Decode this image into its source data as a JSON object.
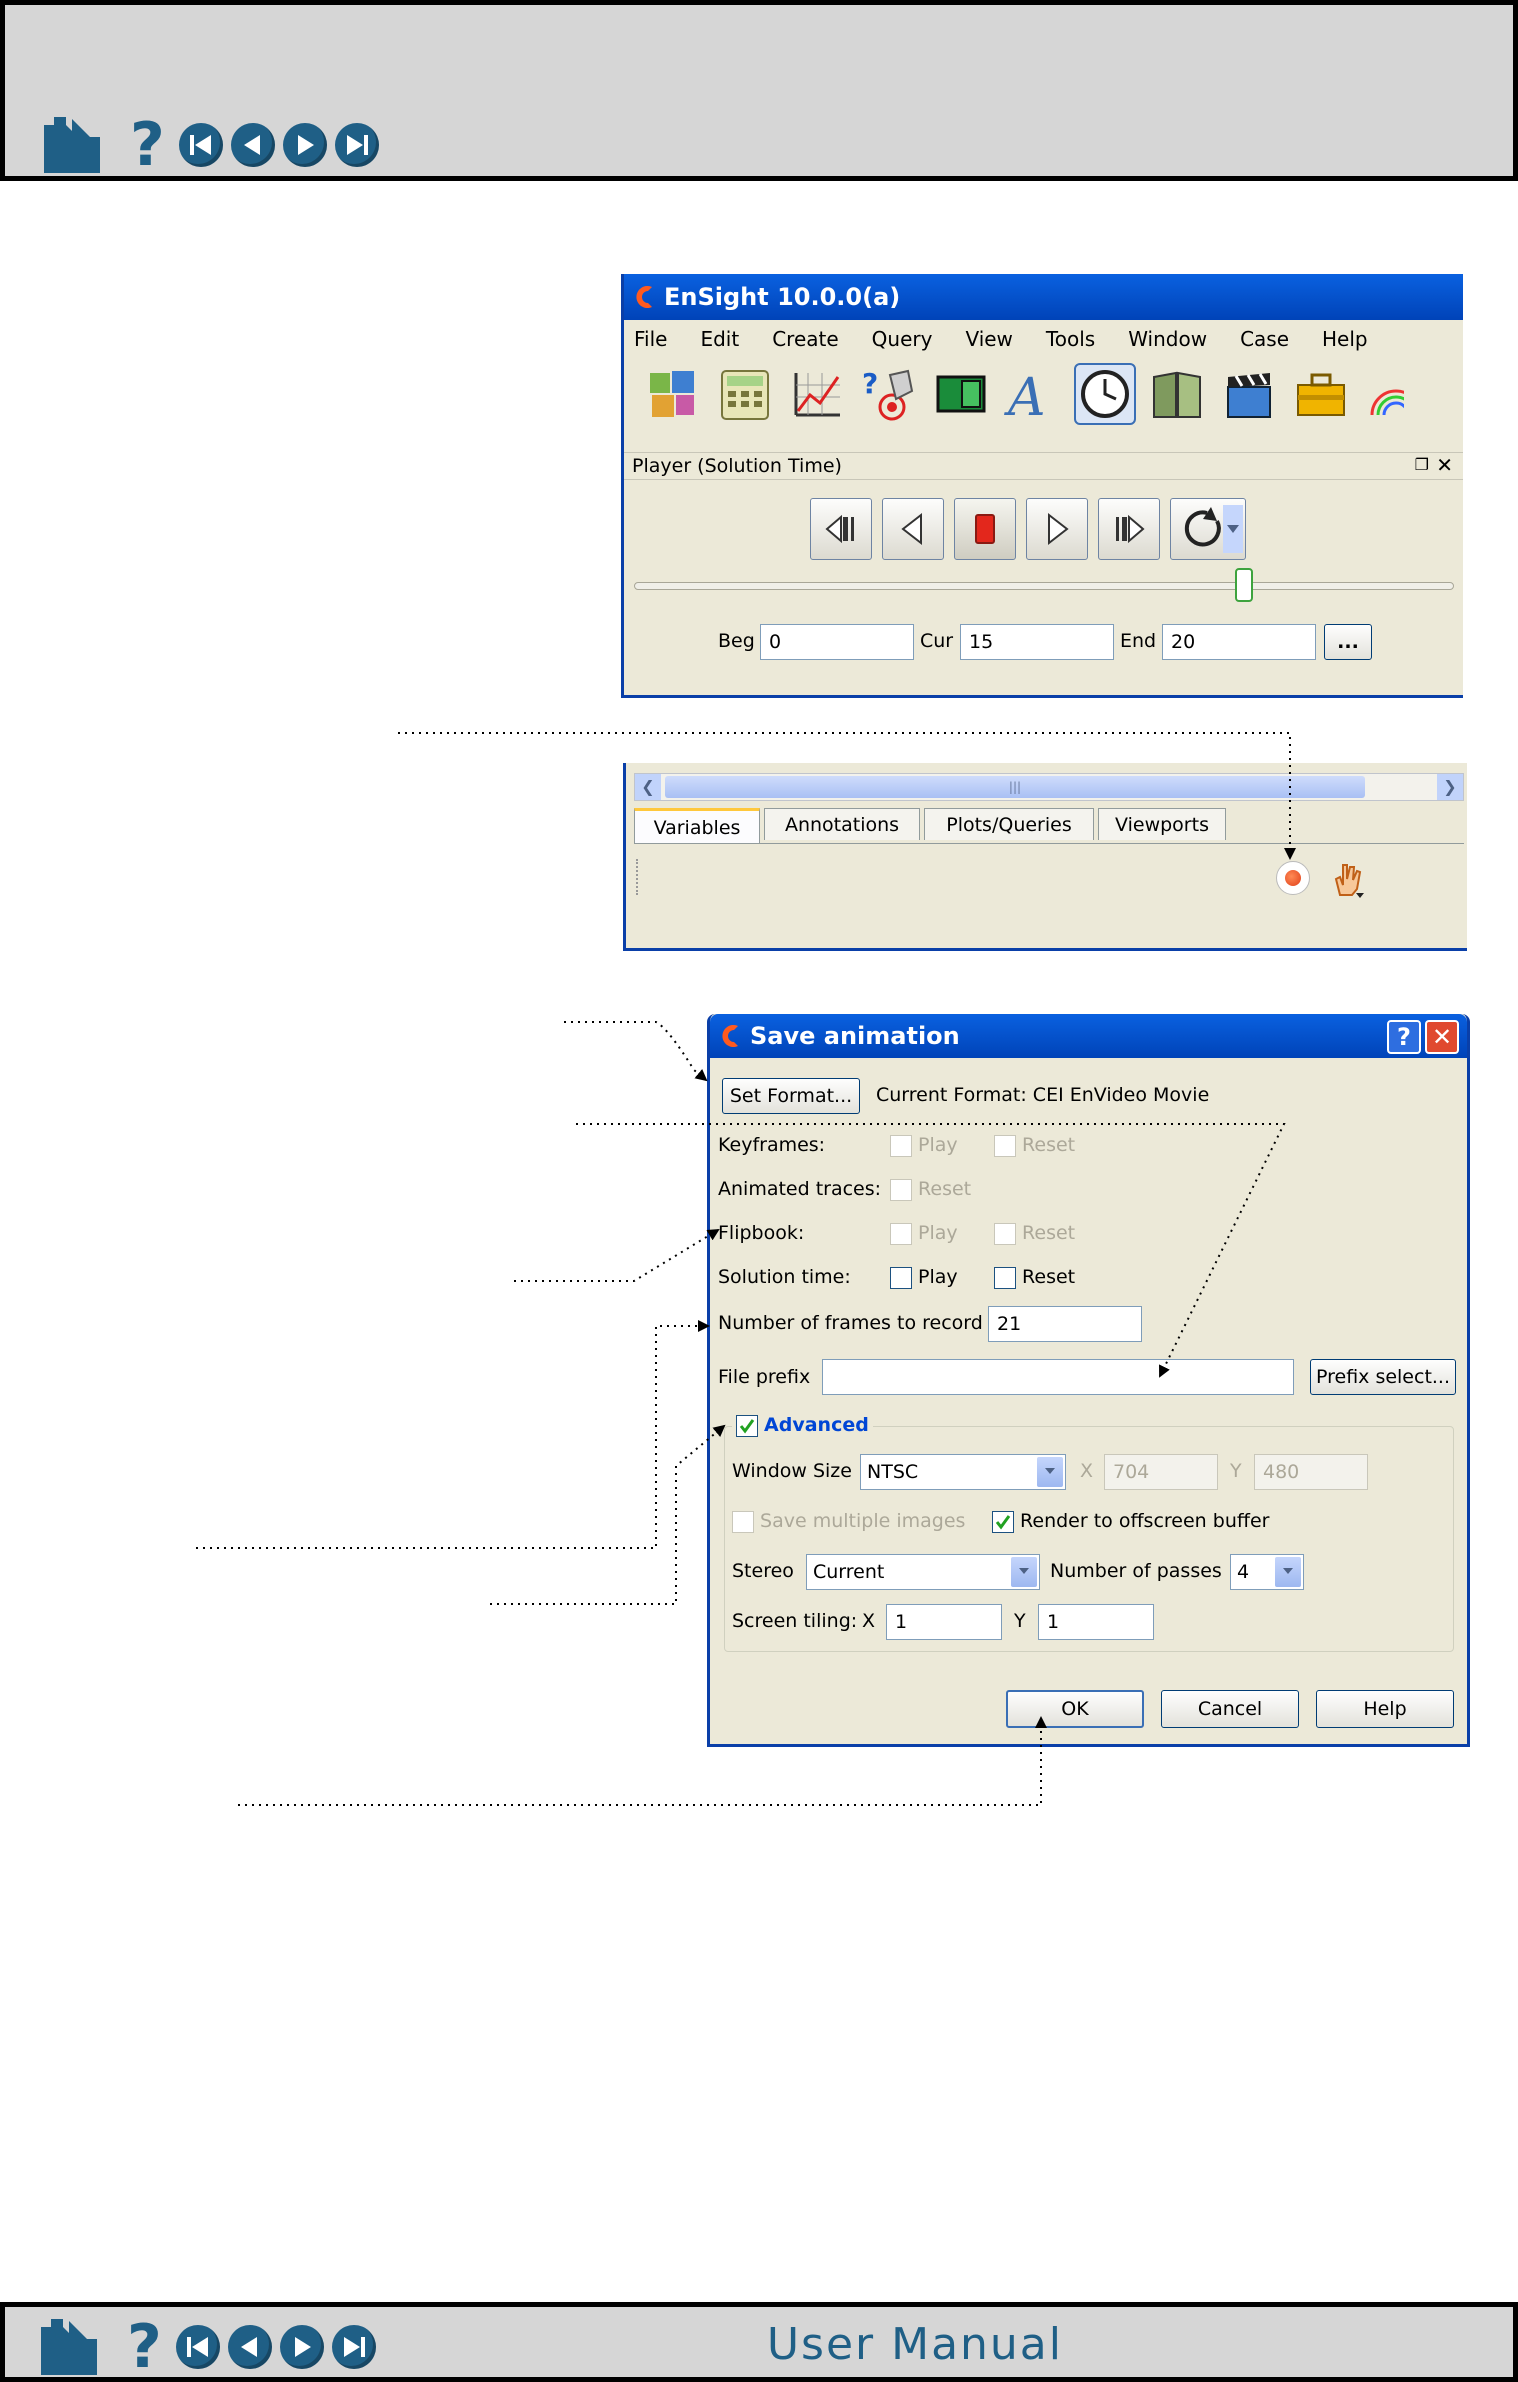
{
  "header": {
    "nav_icons": [
      "home-icon",
      "help-icon",
      "first-page-icon",
      "previous-page-icon",
      "next-page-icon",
      "last-page-icon"
    ],
    "help_glyph": "?"
  },
  "footer": {
    "title": "User Manual",
    "help_glyph": "?"
  },
  "ensight": {
    "title": "EnSight 10.0.0(a)",
    "menu": [
      "File",
      "Edit",
      "Create",
      "Query",
      "View",
      "Tools",
      "Window",
      "Case",
      "Help"
    ],
    "toolbar_icons": [
      "parts-icon",
      "calculator-icon",
      "plot-icon",
      "query-icon",
      "viewport-icon",
      "annotation-icon",
      "clock-icon",
      "book-icon",
      "clapper-icon",
      "toolbox-icon",
      "rainbow-icon"
    ],
    "player": {
      "title": "Player (Solution Time)",
      "buttons": [
        "step-to-start-icon",
        "play-backward-icon",
        "stop-icon",
        "play-forward-icon",
        "step-to-end-icon",
        "loop-icon"
      ],
      "slider_fraction": 0.75,
      "beg_label": "Beg",
      "beg_value": "0",
      "cur_label": "Cur",
      "cur_value": "15",
      "end_label": "End",
      "end_value": "20",
      "more_label": "..."
    }
  },
  "panel": {
    "scroll_grip": "|||",
    "tabs": [
      "Variables",
      "Annotations",
      "Plots/Queries",
      "Viewports"
    ],
    "record_icon": "record-icon",
    "hand_icon": "hand-icon"
  },
  "save_dialog": {
    "title": "Save animation",
    "set_format_label": "Set Format...",
    "current_format": "Current Format: CEI EnVideo Movie",
    "keyframes_label": "Keyframes:",
    "animated_traces_label": "Animated traces:",
    "flipbook_label": "Flipbook:",
    "solution_time_label": "Solution time:",
    "play_label": "Play",
    "reset_label": "Reset",
    "frames_label": "Number of frames to record",
    "frames_value": "21",
    "file_prefix_label": "File prefix",
    "file_prefix_value": "",
    "prefix_select_label": "Prefix select...",
    "advanced_label": "Advanced",
    "window_size_label": "Window Size",
    "window_size_value": "NTSC",
    "x_label": "X",
    "x_value": "704",
    "y_label": "Y",
    "y_value": "480",
    "save_multiple_label": "Save multiple images",
    "render_offscreen_label": "Render to offscreen buffer",
    "stereo_label": "Stereo",
    "stereo_value": "Current",
    "passes_label": "Number of passes",
    "passes_value": "4",
    "tiling_label": "Screen tiling:",
    "tiling_x_label": "X",
    "tiling_x_value": "1",
    "tiling_y_label": "Y",
    "tiling_y_value": "1",
    "ok_label": "OK",
    "cancel_label": "Cancel",
    "help_label": "Help"
  }
}
